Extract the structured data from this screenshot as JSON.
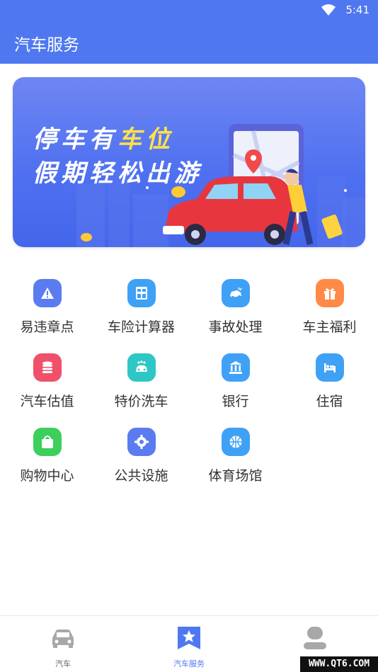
{
  "status_bar": {
    "time": "5:41"
  },
  "app_bar": {
    "title": "汽车服务"
  },
  "banner": {
    "line1_prefix": "停车有",
    "line1_highlight": "车位",
    "line2": "假期轻松出游"
  },
  "services": [
    {
      "label": "易违章点",
      "icon": "warning-icon",
      "color": "#5b7cf0"
    },
    {
      "label": "车险计算器",
      "icon": "calculator-icon",
      "color": "#3fa1f5"
    },
    {
      "label": "事故处理",
      "icon": "car-crash-icon",
      "color": "#3fa1f5"
    },
    {
      "label": "车主福利",
      "icon": "gift-icon",
      "color": "#ff8a47"
    },
    {
      "label": "汽车估值",
      "icon": "coins-icon",
      "color": "#f0506a"
    },
    {
      "label": "特价洗车",
      "icon": "car-wash-icon",
      "color": "#2ec7c5"
    },
    {
      "label": "银行",
      "icon": "bank-icon",
      "color": "#3fa1f5"
    },
    {
      "label": "住宿",
      "icon": "bed-icon",
      "color": "#3fa1f5"
    },
    {
      "label": "购物中心",
      "icon": "shopping-bag-icon",
      "color": "#3ccf5c"
    },
    {
      "label": "公共设施",
      "icon": "gear-icon",
      "color": "#5b7cf0"
    },
    {
      "label": "体育场馆",
      "icon": "basketball-icon",
      "color": "#3fa1f5"
    }
  ],
  "bottom_nav": [
    {
      "label": "汽车",
      "icon": "car-icon",
      "active": false
    },
    {
      "label": "汽车服务",
      "icon": "star-badge-icon",
      "active": true
    },
    {
      "label": "",
      "icon": "profile-icon",
      "active": false
    }
  ],
  "watermark": "WWW.QT6.COM",
  "colors": {
    "primary": "#4f78f0",
    "inactive_icon": "#a8a8a8"
  }
}
